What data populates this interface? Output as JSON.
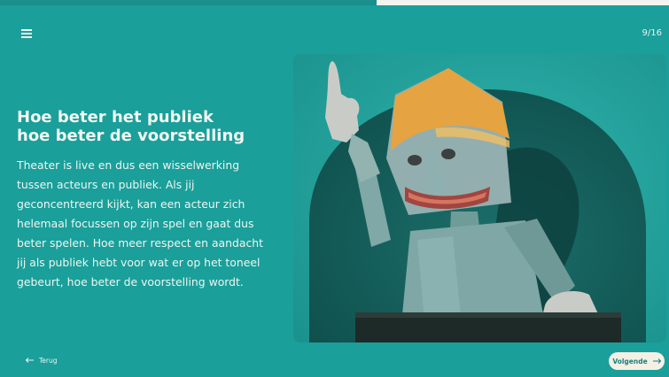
{
  "progress": {
    "fraction": 0.5625
  },
  "header": {
    "page_counter": "9/16",
    "menu_icon": "hamburger-menu-icon"
  },
  "content": {
    "heading_lines": [
      "Hoe beter het publiek",
      "hoe beter de voorstelling"
    ],
    "body_lines": [
      "Theater is live en dus een wisselwerking",
      "tussen acteurs en publiek. Als jij",
      "geconcentreerd kijkt, kan een acteur zich",
      "helemaal focussen op zijn spel en gaat dus",
      "beter spelen. Hoe meer respect en aandacht",
      "jij als publiek hebt voor wat er op het toneel",
      "gebeurt, hoe beter de voorstelling wordt."
    ]
  },
  "footer": {
    "back_label": "Terug",
    "next_label": "Volgende",
    "back_icon": "arrow-left-icon",
    "next_icon": "arrow-right-icon"
  },
  "colors": {
    "background": "#1a9f9b",
    "button_bg": "#f4f0e4",
    "button_text": "#17817d",
    "progress_track": "#f3f3ef"
  }
}
